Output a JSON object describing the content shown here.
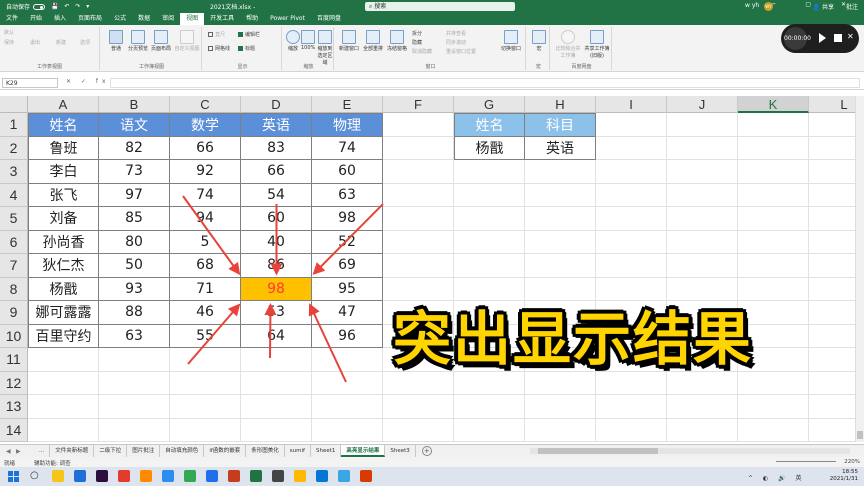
{
  "titlebar": {
    "autosave_label": "自动保存",
    "qat_icons": "💾 ↶ ↷ ▾",
    "filename": "2021文档.xlsx  -",
    "search_placeholder": "搜索",
    "user": "w yh",
    "avatar_initials": "WY",
    "window_controls": "─ ▢ ✕"
  },
  "ribbon_tabs": [
    "文件",
    "开始",
    "插入",
    "页面布局",
    "公式",
    "数据",
    "审阅",
    "视图",
    "开发工具",
    "帮助",
    "Power Pivot",
    "百度网盘"
  ],
  "active_tab": "视图",
  "share_label": "共享",
  "comment_label": "批注",
  "ribbon": {
    "groups": [
      {
        "label": "工作表视图",
        "items": [
          "默认",
          "保持",
          "退出",
          "新建",
          "选项"
        ]
      },
      {
        "label": "工作簿视图",
        "items": [
          "普通",
          "分页预览",
          "页面布局",
          "自定义视图"
        ]
      },
      {
        "label": "显示",
        "items": [
          "直尺",
          "编辑栏",
          "网格线",
          "标题"
        ]
      },
      {
        "label": "缩放",
        "items": [
          "缩放",
          "100%",
          "缩放到选定区域"
        ]
      },
      {
        "label": "窗口",
        "items": [
          "新建窗口",
          "全部重排",
          "冻结窗格",
          "拆分",
          "隐藏",
          "取消隐藏",
          "并排查看",
          "同步滚动",
          "重设窗口位置",
          "切换窗口"
        ]
      },
      {
        "label": "宏",
        "items": [
          "宏"
        ]
      },
      {
        "label": "百度网盘",
        "items": [
          "比较和合并工作簿",
          "共享工作簿(旧版)"
        ]
      }
    ]
  },
  "recorder": {
    "time": "00:00:00"
  },
  "formula_bar": {
    "name_box": "K29",
    "fx": "✕ ✓ fx",
    "value": ""
  },
  "columns": [
    "A",
    "B",
    "C",
    "D",
    "E",
    "F",
    "G",
    "H",
    "I",
    "J",
    "K",
    "L"
  ],
  "selected_column": "K",
  "rows": [
    "1",
    "2",
    "3",
    "4",
    "5",
    "6",
    "7",
    "8",
    "9",
    "10",
    "11",
    "12",
    "13",
    "14"
  ],
  "table1": {
    "headers": [
      "姓名",
      "语文",
      "数学",
      "英语",
      "物理"
    ],
    "rows": [
      [
        "鲁班",
        "82",
        "66",
        "83",
        "74"
      ],
      [
        "李白",
        "73",
        "92",
        "66",
        "60"
      ],
      [
        "张飞",
        "97",
        "74",
        "54",
        "63"
      ],
      [
        "刘备",
        "85",
        "94",
        "60",
        "98"
      ],
      [
        "孙尚香",
        "80",
        "5",
        "40",
        "52"
      ],
      [
        "狄仁杰",
        "50",
        "68",
        "86",
        "69"
      ],
      [
        "杨戬",
        "93",
        "71",
        "98",
        "95"
      ],
      [
        "娜可露露",
        "88",
        "46",
        "53",
        "47"
      ],
      [
        "百里守约",
        "63",
        "55",
        "64",
        "96"
      ]
    ],
    "highlight": {
      "row": 6,
      "col": 3
    }
  },
  "table2": {
    "headers": [
      "姓名",
      "科目"
    ],
    "row": [
      "杨戬",
      "英语"
    ]
  },
  "overlay_title": "突出显示结果",
  "sheet_tabs": [
    "...",
    "文件夹新标题",
    "二级下拉",
    "图片批注",
    "自动填充颜色",
    "if函数的嵌套",
    "条形图美化",
    "sumif",
    "Sheet1",
    "高亮显示结果",
    "Sheet3"
  ],
  "active_sheet": "高亮显示结果",
  "statusbar": {
    "ready": "就绪",
    "accessibility": "辅助功能: 调查",
    "zoom": "220%"
  },
  "taskbar": {
    "time": "18:55",
    "date": "2021/1/31"
  },
  "colors": {
    "excel_green": "#217346",
    "header_blue": "#5b8fd8",
    "header_light_blue": "#8cc1ea",
    "highlight": "#ffc000",
    "highlight_text": "#ff3a3a",
    "title_yellow": "#ffd400",
    "arrow_red": "#e8423a"
  }
}
